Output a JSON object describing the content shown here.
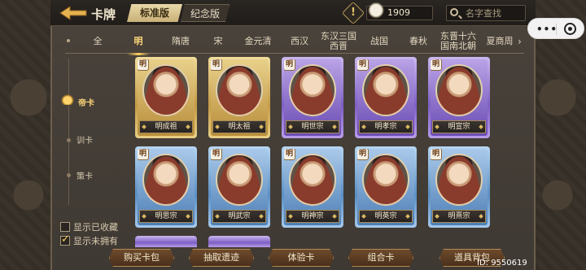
{
  "header": {
    "title": "卡牌",
    "version_tabs": [
      "标准版",
      "纪念版"
    ],
    "currency_value": "1909",
    "search_placeholder": "名字查找"
  },
  "mini_program": {
    "more": "•••"
  },
  "eras": [
    "全",
    "明",
    "隋唐",
    "宋",
    "金元清",
    "西汉",
    "东汉三国西晋",
    "战国",
    "春秋",
    "东晋十六国南北朝",
    "夏商周"
  ],
  "active_era": "明",
  "categories": [
    "帝卡",
    "训卡",
    "策卡"
  ],
  "cards": [
    {
      "name": "明成祖",
      "badge": "明",
      "frame": "gold"
    },
    {
      "name": "明太祖",
      "badge": "明",
      "frame": "gold"
    },
    {
      "name": "明世宗",
      "badge": "明",
      "frame": "purple"
    },
    {
      "name": "明孝宗",
      "badge": "明",
      "frame": "purple"
    },
    {
      "name": "明宣宗",
      "badge": "明",
      "frame": "purple"
    },
    {
      "name": "明思宗",
      "badge": "明",
      "frame": "blue"
    },
    {
      "name": "明武宗",
      "badge": "明",
      "frame": "blue"
    },
    {
      "name": "明神宗",
      "badge": "明",
      "frame": "blue"
    },
    {
      "name": "明英宗",
      "badge": "明",
      "frame": "blue"
    },
    {
      "name": "明熹宗",
      "badge": "明",
      "frame": "blue"
    }
  ],
  "filters": {
    "show_collected": "显示已收藏",
    "show_unowned": "显示未拥有"
  },
  "buttons": [
    "购买卡包",
    "抽取遗迹",
    "体验卡",
    "组合卡",
    "道具背包"
  ],
  "user_id": "ID: 9550619"
}
